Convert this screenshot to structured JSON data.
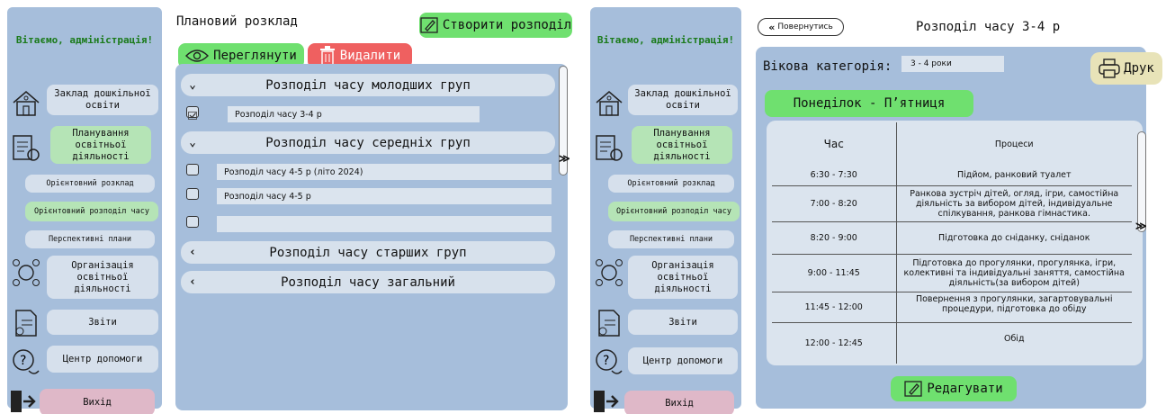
{
  "sidebar": {
    "welcome": "Вітаємо, адміністрація!",
    "zaklad": "Заклад дошкільної освіти",
    "planning": "Планування освітньої діяльності",
    "orient_schedule": "Орієнтовний розклад",
    "orient_time": "Орієнтовний розподіл часу",
    "perspective": "Перспективні плани",
    "organization": "Організація освітньої діяльності",
    "reports": "Звіти",
    "help": "Центр допомоги",
    "exit": "Вихід"
  },
  "screen1": {
    "title": "Плановий розклад",
    "create_button": "Створити розподіл",
    "view_button": "Переглянути",
    "delete_button": "Видалити",
    "groups": [
      {
        "label": "Розподіл часу молодших груп",
        "expanded": true
      },
      {
        "label": "Розподіл часу середніх груп",
        "expanded": true
      },
      {
        "label": "Розподіл часу старших груп",
        "expanded": false
      },
      {
        "label": "Розподіл часу загальний",
        "expanded": false
      }
    ],
    "junior_items": [
      {
        "text": "Розподіл часу 3-4 р",
        "checked": true
      }
    ],
    "middle_items": [
      {
        "text": "Розподіл часу 4-5 р (літо 2024)",
        "checked": false
      },
      {
        "text": "Розподіл часу 4-5 р",
        "checked": false
      },
      {
        "text": "",
        "checked": false
      }
    ]
  },
  "screen2": {
    "back_button": "Повернутись",
    "title": "Розподіл часу 3-4 р",
    "age_label": "Вікова категорія:",
    "age_value": "3 - 4 роки",
    "print_button": "Друк",
    "days_label": "Понеділок - П’ятниця",
    "col_time": "Час",
    "col_process": "Процеси",
    "rows": [
      {
        "time": "6:30 - 7:30",
        "process": "Підйом, ранковий туалет"
      },
      {
        "time": "7:00 - 8:20",
        "process": "Ранкова зустріч дітей, огляд, ігри, самостійна діяльність за вибором дітей, індивідуальне спілкування, ранкова гімнастика."
      },
      {
        "time": "8:20 - 9:00",
        "process": "Підготовка до сніданку, сніданок"
      },
      {
        "time": "9:00 - 11:45",
        "process": "Підготовка до прогулянки, прогулянка, ігри, колективні та індивідуальні заняття, самостійна діяльність(за вибором дітей)"
      },
      {
        "time": "11:45 - 12:00",
        "process": "Повернення з прогулянки, загартовувальні процедури, підготовка до обіду"
      },
      {
        "time": "12:00 - 12:45",
        "process": "Обід"
      }
    ],
    "edit_button": "Редагувати"
  },
  "colors": {
    "panel": "#a6bedb",
    "green": "#6fe06f",
    "red": "#ef6060",
    "welcome": "#1a7a1a"
  }
}
